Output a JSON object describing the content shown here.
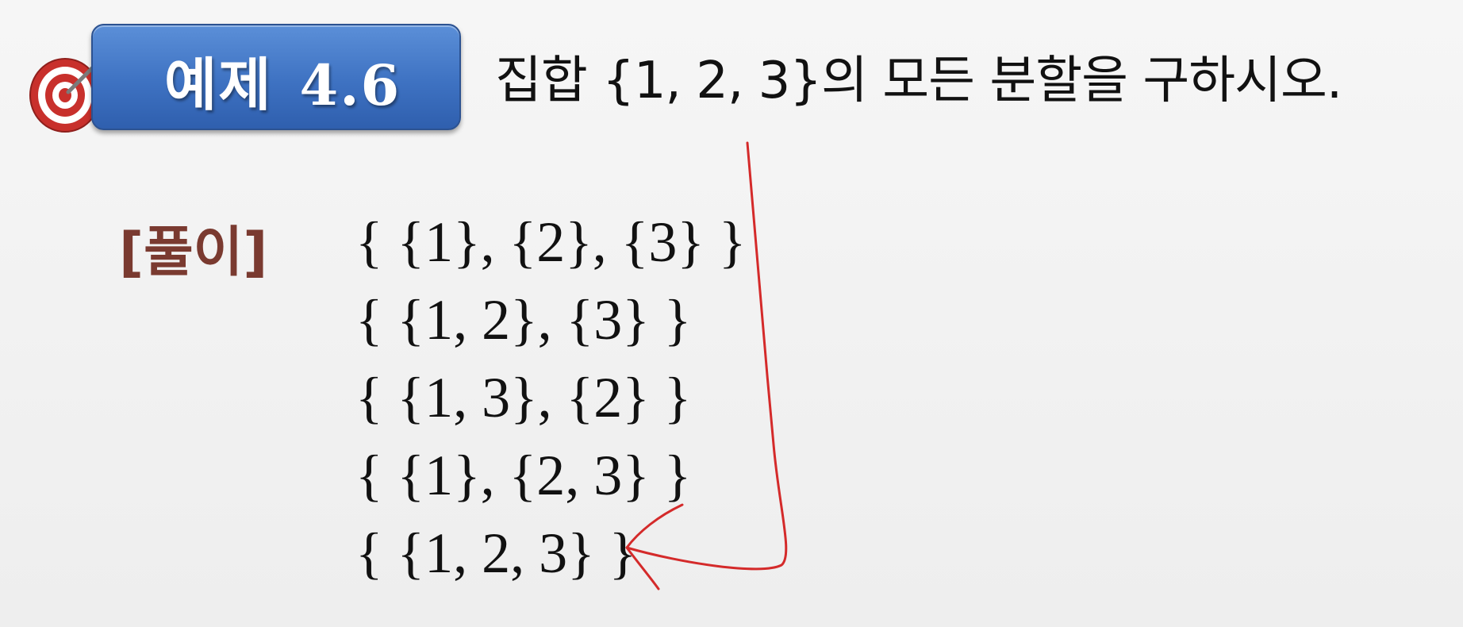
{
  "example": {
    "label": "예제",
    "number": "4.6"
  },
  "question": "집합 {1, 2, 3}의 모든 분할을 구하시오.",
  "solution": {
    "label": "[풀이]",
    "partitions": [
      "{ {1}, {2}, {3} }",
      "{ {1, 2}, {3} }",
      "{ {1, 3}, {2} }",
      "{ {1}, {2, 3} }",
      "{ {1, 2, 3} }"
    ]
  },
  "colors": {
    "badge": "#3e72c2",
    "solution_label": "#7a3a30",
    "annotation_arrow": "#d42a2a",
    "target_red": "#c8302c"
  },
  "icons": {
    "target": "target-with-dart-icon",
    "annotation": "hand-drawn-arrow"
  }
}
